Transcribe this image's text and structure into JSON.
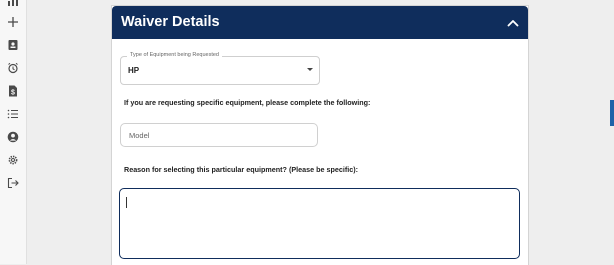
{
  "sidebar": {
    "icons": [
      {
        "name": "chart-icon"
      },
      {
        "name": "add-icon"
      },
      {
        "name": "id-card-icon"
      },
      {
        "name": "alarm-clock-icon"
      },
      {
        "name": "dollar-document-icon"
      },
      {
        "name": "list-icon"
      },
      {
        "name": "user-circle-icon"
      },
      {
        "name": "settings-icon"
      },
      {
        "name": "logout-icon"
      }
    ]
  },
  "panel": {
    "title": "Waiver Details",
    "collapse_icon": "chevron-up-icon"
  },
  "equipment_type": {
    "label": "Type of Equipment being Requested",
    "value": "HP"
  },
  "specific_instruction": "If you are requesting specific equipment, please complete the following:",
  "model": {
    "placeholder": "Model",
    "value": ""
  },
  "reason": {
    "label": "Reason for selecting this particular equipment?  (Please be specific):",
    "value": ""
  },
  "colors": {
    "header_bg": "#0f2d5c",
    "accent": "#1f62a8"
  }
}
